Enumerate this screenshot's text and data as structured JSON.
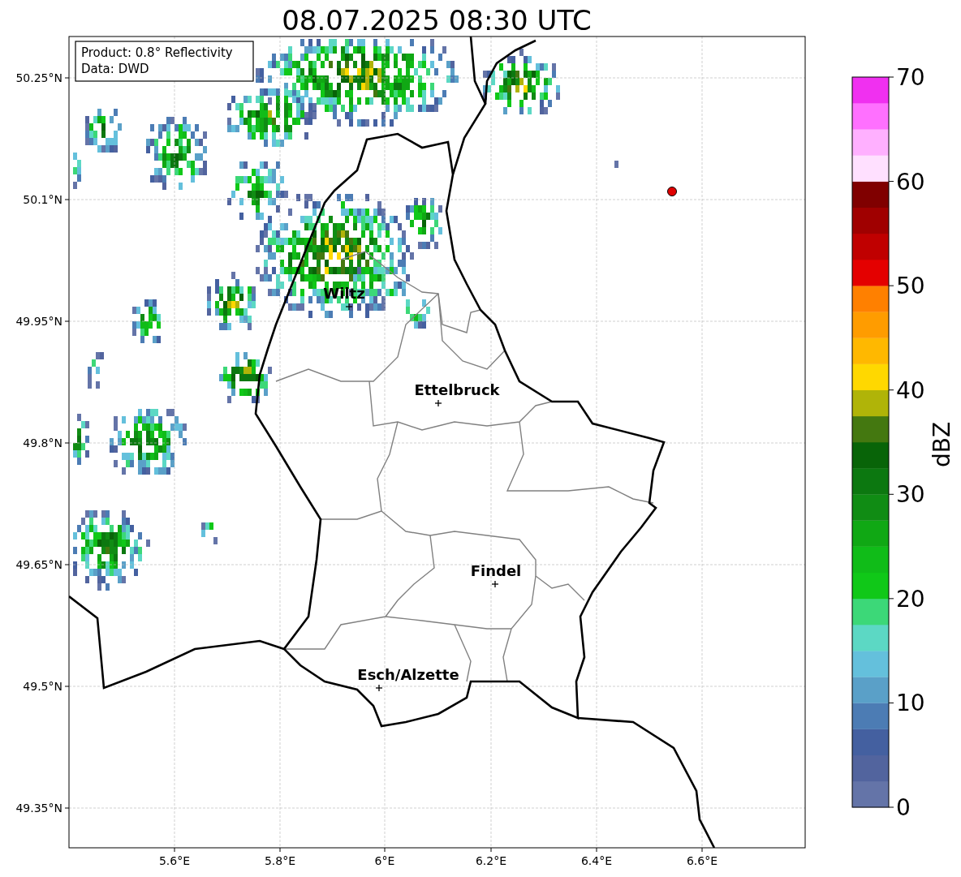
{
  "title": "08.07.2025 08:30 UTC",
  "info_box": [
    "Product: 0.8° Reflectivity",
    "Data: DWD"
  ],
  "map": {
    "cities": [
      {
        "name": "Wiltz"
      },
      {
        "name": "Ettelbruck"
      },
      {
        "name": "Findel"
      },
      {
        "name": "Esch/Alzette"
      }
    ],
    "latitude_ticks": [
      "50.25°N",
      "50.1°N",
      "49.95°N",
      "49.8°N",
      "49.65°N",
      "49.5°N",
      "49.35°N"
    ],
    "longitude_ticks": [
      "5.6°E",
      "5.8°E",
      "6°E",
      "6.2°E",
      "6.4°E",
      "6.6°E"
    ]
  },
  "colorbar": {
    "label": "dBZ",
    "ticks": [
      "70",
      "60",
      "50",
      "40",
      "30",
      "20",
      "10",
      "0"
    ],
    "segments": [
      {
        "color": "#6474a8"
      },
      {
        "color": "#52649e"
      },
      {
        "color": "#4460a0"
      },
      {
        "color": "#4c7cb4"
      },
      {
        "color": "#5aa0c8"
      },
      {
        "color": "#64c0dc"
      },
      {
        "color": "#5cd8c4"
      },
      {
        "color": "#3cd878"
      },
      {
        "color": "#10c818"
      },
      {
        "color": "#10bc18"
      },
      {
        "color": "#10a814"
      },
      {
        "color": "#108c14"
      },
      {
        "color": "#0c7810"
      },
      {
        "color": "#086408"
      },
      {
        "color": "#447810"
      },
      {
        "color": "#b0b408"
      },
      {
        "color": "#ffd800"
      },
      {
        "color": "#ffb800"
      },
      {
        "color": "#ff9c00"
      },
      {
        "color": "#ff8000"
      },
      {
        "color": "#e40000"
      },
      {
        "color": "#c00000"
      },
      {
        "color": "#a00000"
      },
      {
        "color": "#800000"
      },
      {
        "color": "#ffe0ff"
      },
      {
        "color": "#ffb0ff"
      },
      {
        "color": "#ff70ff"
      },
      {
        "color": "#f030f0"
      }
    ]
  }
}
